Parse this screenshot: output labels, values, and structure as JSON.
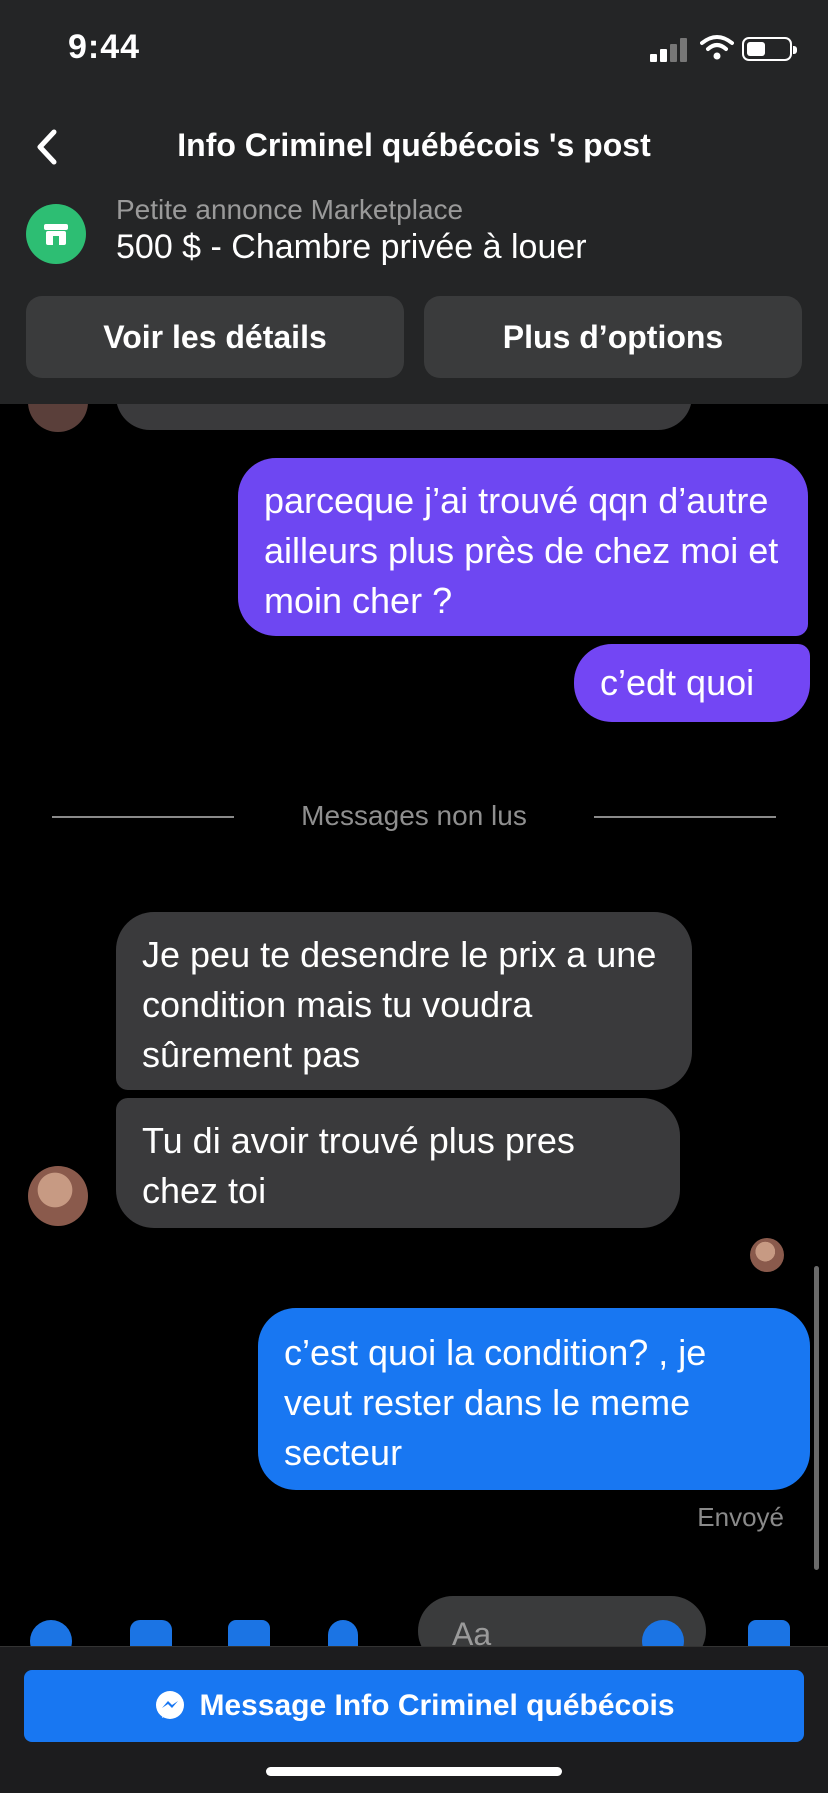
{
  "status_bar": {
    "time": "9:44"
  },
  "header": {
    "title": "Info Criminel québécois 's post"
  },
  "marketplace": {
    "subtitle": "Petite annonce Marketplace",
    "listing": "500 $ - Chambre privée à louer",
    "buttons": {
      "details": "Voir les détails",
      "options": "Plus d’options"
    }
  },
  "messages": [
    {
      "side": "sent",
      "text": "parceque j’ai trouvé qqn d’autre ailleurs plus près de chez moi et moin cher ?"
    },
    {
      "side": "sent",
      "text": "c’edt quoi"
    },
    {
      "side": "received",
      "text": "Je peu te desendre le prix a une condition mais tu voudra sûrement pas"
    },
    {
      "side": "received",
      "text": "Tu di avoir trouvé plus pres chez toi"
    },
    {
      "side": "sent",
      "text": "c’est quoi la condition? , je veut rester dans le meme secteur"
    }
  ],
  "divider_label": "Messages non lus",
  "sent_status": "Envoyé",
  "composer": {
    "placeholder": "Aa"
  },
  "bottom_button": {
    "label": "Message Info Criminel québécois"
  },
  "colors": {
    "sent_purple": "#6e47f2",
    "sent_blue": "#1877f2",
    "received_gray": "#3a3a3c",
    "header_bg": "#242526"
  }
}
